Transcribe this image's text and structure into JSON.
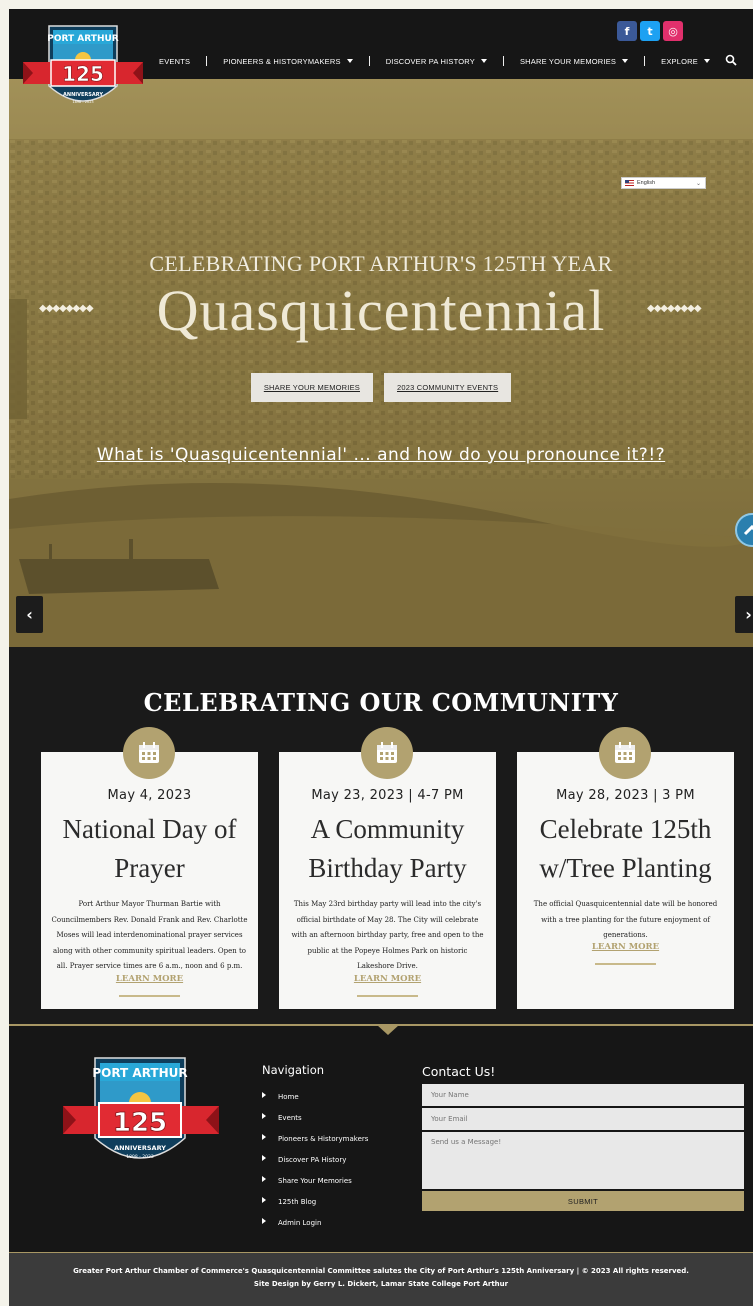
{
  "header": {
    "logo_alt": "Port Arthur 125th Anniversary",
    "logo_text": {
      "top": "PORT ARTHUR",
      "number": "125",
      "ribbon": "ANNIVERSARY",
      "years": "1898 - 2023"
    },
    "social": [
      {
        "name": "facebook",
        "color": "#3b5998",
        "glyph": "f"
      },
      {
        "name": "twitter",
        "color": "#1da1f2",
        "glyph": "t"
      },
      {
        "name": "instagram",
        "color": "#e1306c",
        "glyph": "◎"
      }
    ],
    "nav": [
      {
        "label": "EVENTS",
        "dropdown": false
      },
      {
        "label": "PIONEERS & HISTORYMAKERS",
        "dropdown": true
      },
      {
        "label": "DISCOVER PA HISTORY",
        "dropdown": true
      },
      {
        "label": "SHARE YOUR MEMORIES",
        "dropdown": true
      },
      {
        "label": "EXPLORE",
        "dropdown": true
      }
    ]
  },
  "hero": {
    "language": "English",
    "subtitle": "CELEBRATING PORT ARTHUR'S 125TH YEAR",
    "title": "Quasquicentennial",
    "diamonds": "◆◆◆◆◆◆◆◆",
    "buttons": [
      "SHARE YOUR MEMORIES",
      "2023 COMMUNITY EVENTS"
    ],
    "link": "What is 'Quasquicentennial' ... and how do you pronounce it?!?",
    "prev": "‹",
    "next": "›"
  },
  "community": {
    "heading": "CELEBRATING OUR COMMUNITY",
    "cards": [
      {
        "date": "May 4, 2023",
        "title_lines": [
          "National Day of",
          "Prayer"
        ],
        "description": "Port Arthur Mayor Thurman Bartie with Councilmembers Rev. Donald Frank and Rev. Charlotte Moses will lead interdenominational prayer services along with other community spiritual leaders. Open to all. Prayer service times are 6 a.m., noon and 6 p.m.",
        "link": "LEARN MORE"
      },
      {
        "date": "May 23, 2023 | 4-7 PM",
        "title_lines": [
          "A Community",
          "Birthday Party"
        ],
        "description": "This May 23rd birthday party will lead into the city's official birthdate of  May 28. The City will celebrate with an afternoon birthday party, free and open to the public at the Popeye Holmes Park on historic Lakeshore Drive.",
        "link": "LEARN MORE"
      },
      {
        "date": "May 28, 2023 | 3 PM",
        "title_lines": [
          "Celebrate 125th",
          "w/Tree Planting"
        ],
        "description": "The official Quasquicentennial date will be honored with a tree planting for the future enjoyment of generations.",
        "link": "LEARN MORE"
      }
    ]
  },
  "footer": {
    "nav_title": "Navigation",
    "nav_items": [
      "Home",
      "Events",
      "Pioneers & Historymakers",
      "Discover PA History",
      "Share Your Memories",
      "125th Blog",
      "Admin Login"
    ],
    "contact_title": "Contact Us!",
    "name_placeholder": "Your Name",
    "email_placeholder": "Your Email",
    "message_placeholder": "Send us a Message!",
    "submit_label": "SUBMIT",
    "copyright": "Greater Port Arthur Chamber of Commerce's Quasquicentennial Committee salutes the City of Port Arthur's 125th Anniversary | © 2023 All rights reserved.",
    "credit": "Site Design by Gerry L. Dickert, Lamar State College Port Arthur"
  },
  "colors": {
    "gold": "#b2a270",
    "dark": "#1a1a1a",
    "accent_blue": "#2a7fae"
  }
}
